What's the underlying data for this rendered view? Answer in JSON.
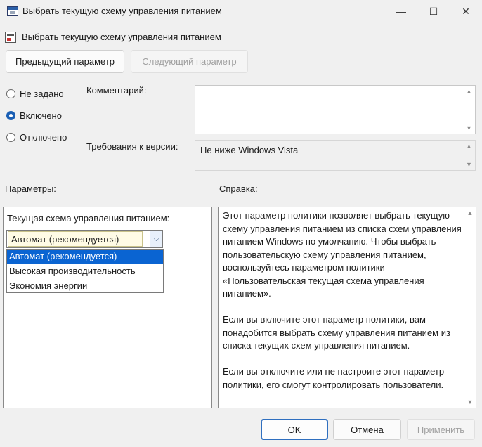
{
  "window": {
    "title": "Выбрать текущую схему управления питанием",
    "controls": {
      "minimize": "—",
      "maximize": "☐",
      "close": "✕"
    }
  },
  "header": {
    "title": "Выбрать текущую схему управления питанием"
  },
  "nav": {
    "prev_label": "Предыдущий параметр",
    "next_label": "Следующий параметр"
  },
  "state": {
    "options": [
      {
        "label": "Не задано",
        "checked": false
      },
      {
        "label": "Включено",
        "checked": true
      },
      {
        "label": "Отключено",
        "checked": false
      }
    ]
  },
  "comment": {
    "label": "Комментарий:",
    "value": ""
  },
  "requirements": {
    "label": "Требования к версии:",
    "value": "Не ниже Windows Vista"
  },
  "parameters": {
    "label": "Параметры:",
    "field_label": "Текущая схема управления питанием:",
    "selected": "Автомат (рекомендуется)",
    "dropdown_options": [
      "Автомат (рекомендуется)",
      "Высокая производительность",
      "Экономия энергии"
    ]
  },
  "help": {
    "label": "Справка:",
    "text": "Этот параметр политики позволяет выбрать текущую схему управления питанием из списка схем управления питанием Windows по умолчанию. Чтобы выбрать пользовательскую схему управления питанием, воспользуйтесь параметром политики «Пользовательская текущая схема управления питанием».\n\nЕсли вы включите этот параметр политики, вам понадобится выбрать схему управления питанием из списка текущих схем управления питанием.\n\nЕсли вы отключите или не настроите этот параметр политики, его смогут контролировать пользователи."
  },
  "footer": {
    "ok_label": "OK",
    "cancel_label": "Отмена",
    "apply_label": "Применить"
  },
  "colors": {
    "accent": "#0a64d2",
    "dialog_bg": "#f0f0f0"
  }
}
